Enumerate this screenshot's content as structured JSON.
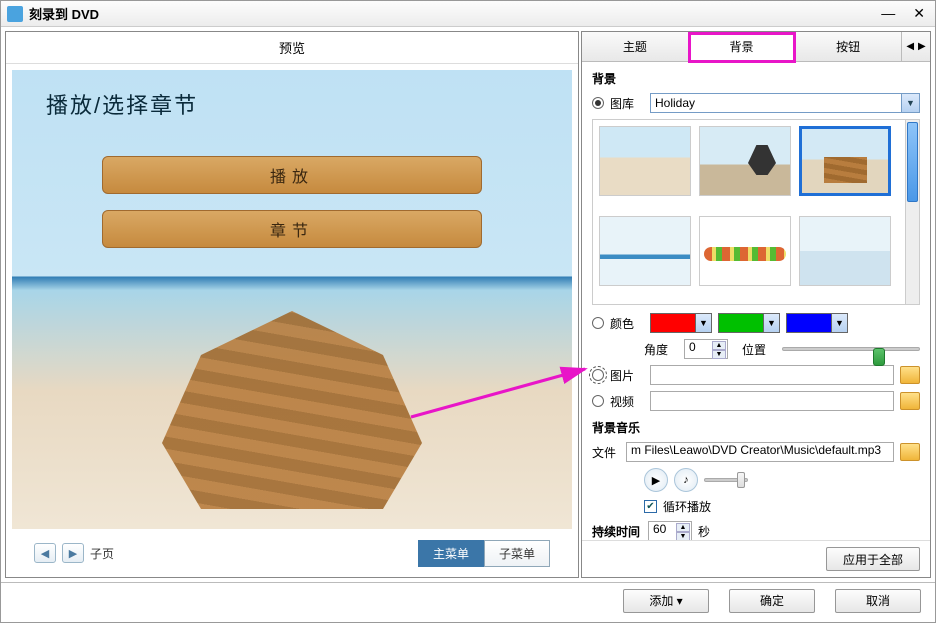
{
  "window": {
    "title": "刻录到 DVD"
  },
  "preview": {
    "header": "预览",
    "headline": "播放/选择章节",
    "play_label": "播放",
    "chapter_label": "章节",
    "subpage_label": "子页",
    "main_menu_tab": "主菜单",
    "sub_menu_tab": "子菜单"
  },
  "tabs": {
    "theme": "主题",
    "background": "背景",
    "button": "按钮"
  },
  "bg": {
    "section": "背景",
    "gallery_label": "图库",
    "gallery_value": "Holiday",
    "color_label": "颜色",
    "angle_label": "角度",
    "angle_value": "0",
    "position_label": "位置",
    "image_label": "图片",
    "video_label": "视频",
    "colors": {
      "red": "#ff0000",
      "green": "#00c000",
      "blue": "#0000ff"
    }
  },
  "music": {
    "section": "背景音乐",
    "file_label": "文件",
    "file_value": "m Files\\Leawo\\DVD Creator\\Music\\default.mp3",
    "loop_label": "循环播放",
    "duration_label": "持续时间",
    "duration_value": "60",
    "seconds_label": "秒"
  },
  "apply_all": "应用于全部",
  "footer": {
    "add": "添加",
    "ok": "确定",
    "cancel": "取消"
  }
}
